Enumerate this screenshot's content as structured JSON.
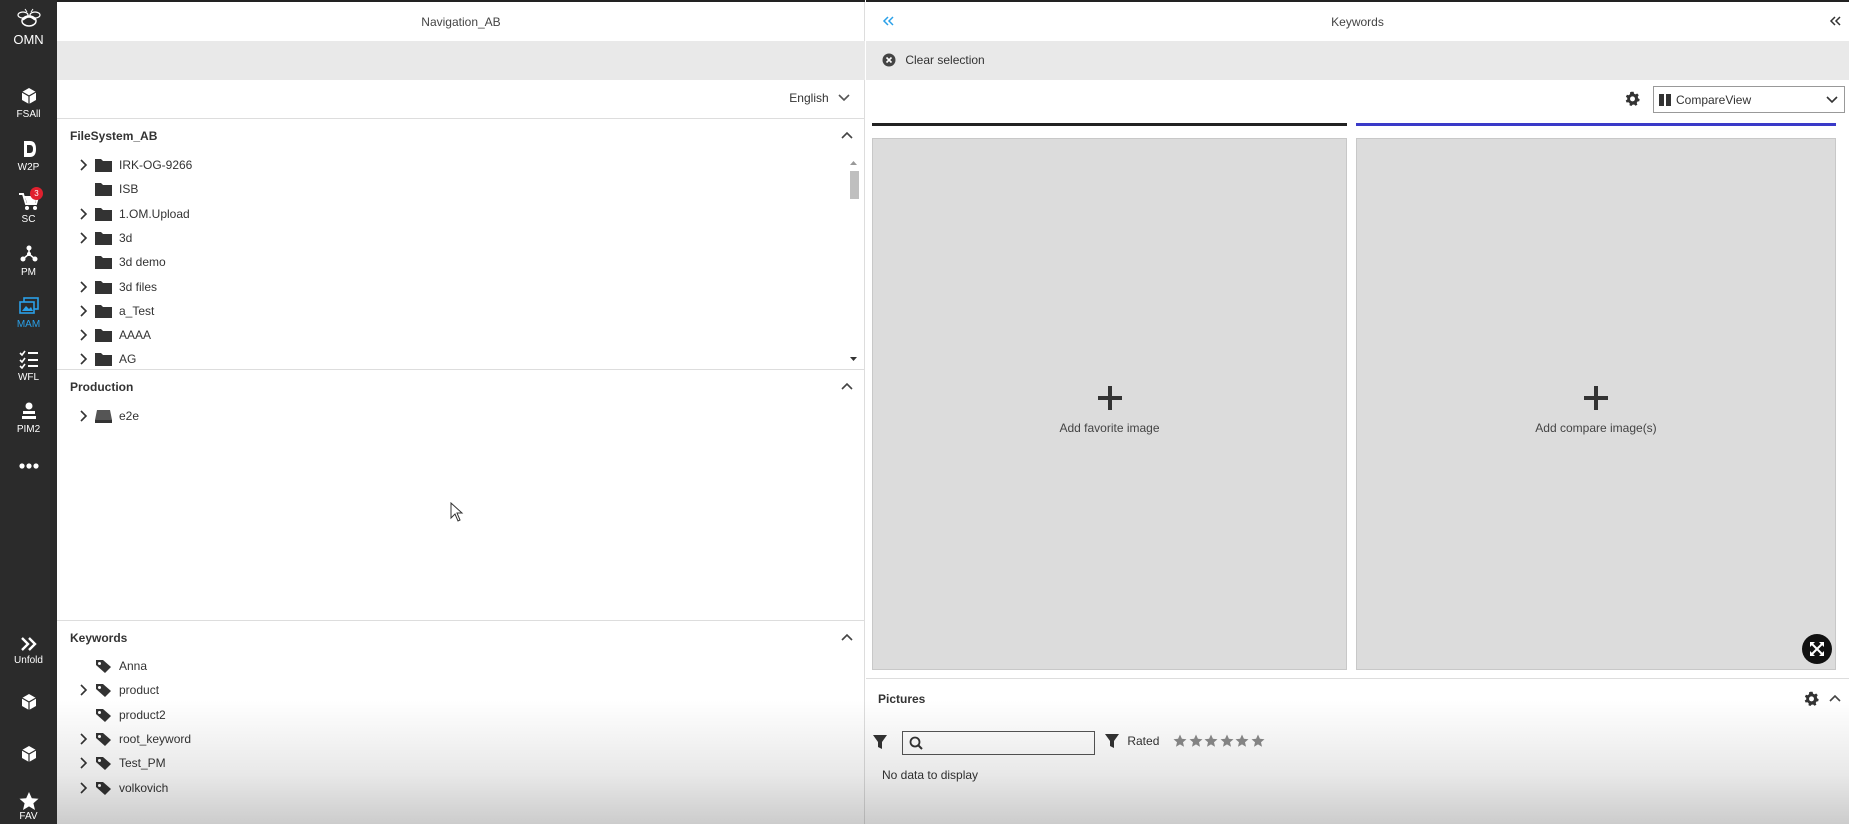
{
  "rail": {
    "logo_label": "OMN",
    "items": [
      {
        "label": "FSAll"
      },
      {
        "label": "W2P"
      },
      {
        "label": "SC",
        "badge": "3"
      },
      {
        "label": "PM"
      },
      {
        "label": "MAM"
      },
      {
        "label": "WFL"
      },
      {
        "label": "PIM2"
      }
    ],
    "more_icon": "more-dots-icon",
    "unfold_label": "Unfold",
    "fav_label": "FAV"
  },
  "navigation": {
    "title": "Navigation_AB",
    "language": "English",
    "filesystem": {
      "title": "FileSystem_AB",
      "items": [
        {
          "label": "IRK-OG-9266",
          "expandable": true
        },
        {
          "label": "ISB",
          "expandable": false
        },
        {
          "label": "1.OM.Upload",
          "expandable": true
        },
        {
          "label": "3d",
          "expandable": true
        },
        {
          "label": "3d demo",
          "expandable": false
        },
        {
          "label": "3d files",
          "expandable": true
        },
        {
          "label": "a_Test",
          "expandable": true
        },
        {
          "label": "AAAA",
          "expandable": true
        },
        {
          "label": "AG",
          "expandable": true
        }
      ]
    },
    "production": {
      "title": "Production",
      "items": [
        {
          "label": "e2e",
          "expandable": true
        }
      ]
    },
    "keywords": {
      "title": "Keywords",
      "items": [
        {
          "label": "Anna",
          "expandable": false
        },
        {
          "label": "product",
          "expandable": true
        },
        {
          "label": "product2",
          "expandable": false
        },
        {
          "label": "root_keyword",
          "expandable": true
        },
        {
          "label": "Test_PM",
          "expandable": true
        },
        {
          "label": "volkovich",
          "expandable": true
        }
      ]
    }
  },
  "keywords_panel": {
    "title": "Keywords",
    "clear_selection": "Clear selection",
    "view_select": "CompareView",
    "favorite": {
      "label": "Add favorite image",
      "accent": "#222222"
    },
    "compare": {
      "label": "Add compare image(s)",
      "accent": "#3a3ac8"
    },
    "pictures": {
      "title": "Pictures",
      "search_placeholder": "",
      "rated_label": "Rated",
      "star_count": 6,
      "empty_text": "No data to display"
    }
  },
  "colors": {
    "rail_bg": "#2b2b2b",
    "active": "#2aa0e8",
    "badge": "#e0202e"
  }
}
